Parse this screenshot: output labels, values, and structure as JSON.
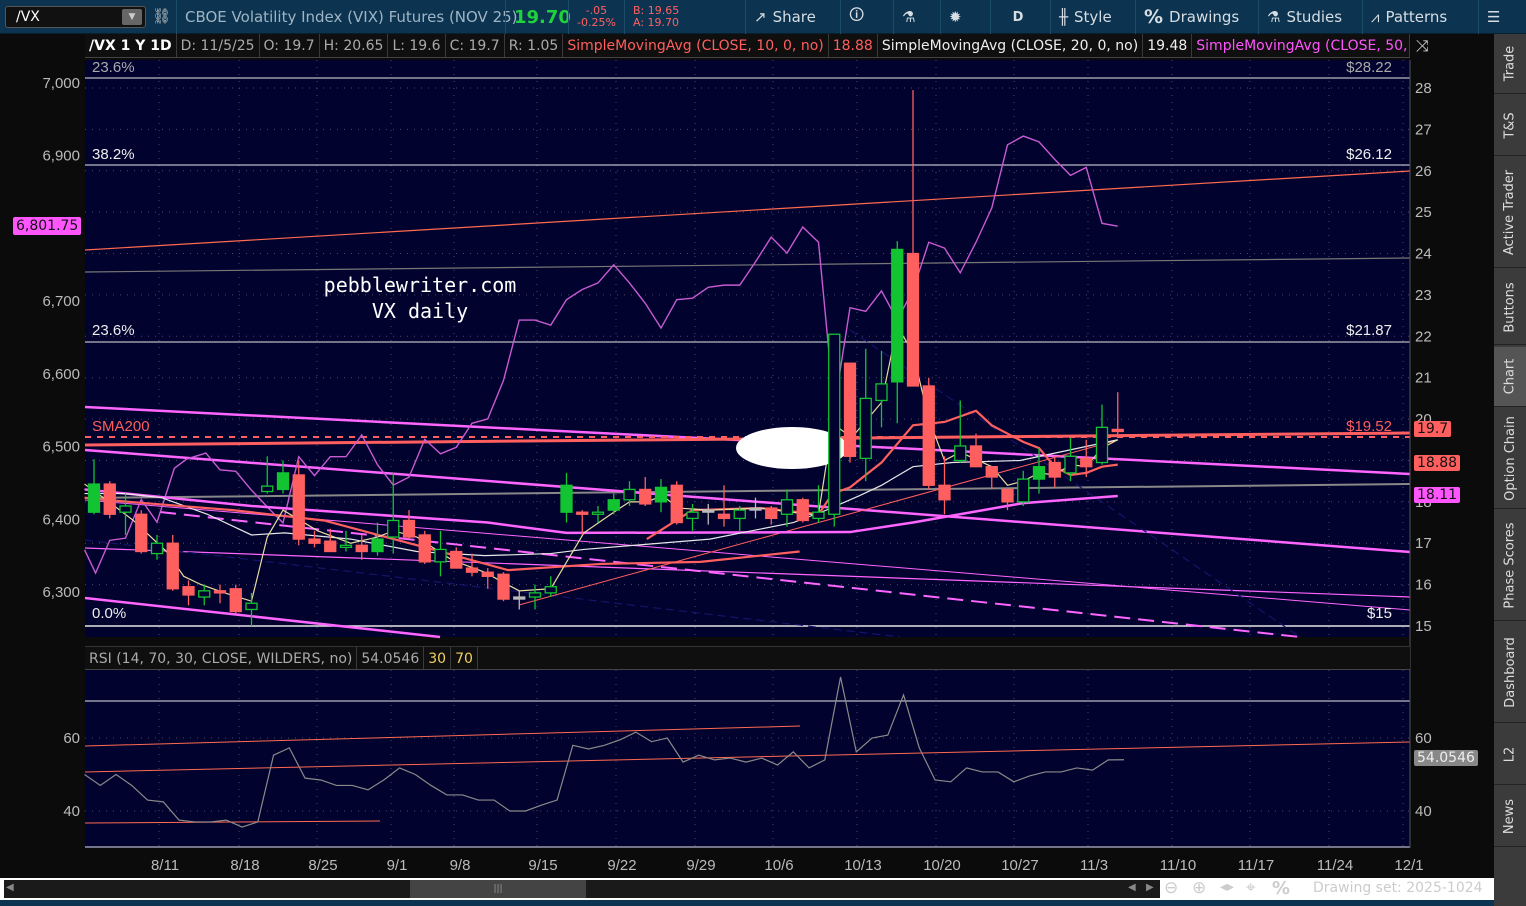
{
  "toolbar": {
    "symbol": "/VX",
    "description": "CBOE Volatility Index (VIX) Futures (NOV 25)",
    "last": "19.70",
    "change": "-.05",
    "change_pct": "-0.25%",
    "bid": "B: 19.65",
    "ask": "A: 19.70",
    "share": "Share",
    "period": "D",
    "style": "Style",
    "drawings": "Drawings",
    "studies": "Studies",
    "patterns": "Patterns"
  },
  "header": {
    "title": "/VX 1 Y 1D",
    "date": "D: 11/5/25",
    "open": "O: 19.7",
    "high": "H: 20.65",
    "low": "L: 19.6",
    "close": "C: 19.7",
    "range": "R: 1.05",
    "sma10_label": "SimpleMovingAvg (CLOSE, 10, 0, no)",
    "sma10_value": "18.88",
    "sma20_label": "SimpleMovingAvg (CLOSE, 20, 0, no)",
    "sma20_value": "19.48",
    "sma50_label": "SimpleMovingAvg (CLOSE, 50,..."
  },
  "colors": {
    "bg": "#02022e",
    "up": "#12c431",
    "down": "#ff5f5f",
    "sma10": "#ff5f5f",
    "sma20": "#e8e8e8",
    "sma50": "#ff66ff",
    "spx": "#c85ad2",
    "fast": "#e8dca0"
  },
  "annotations": {
    "watermark_1": "pebblewriter.com",
    "watermark_2": "VX daily",
    "sma200": "SMA200",
    "fib_top_pct": "23.6%",
    "fib_top_price": "$28.22",
    "fib_382_pct": "38.2%",
    "fib_382_price": "$26.12",
    "fib_236_pct": "23.6%",
    "fib_236_price": "$21.87",
    "fib_0_pct": "0.0%",
    "fib_0_price": "$15",
    "level_1952": "$19.52"
  },
  "left_axis": {
    "ticks": [
      "7,000",
      "6,900",
      "6,700",
      "6,600",
      "6,500",
      "6,400",
      "6,300"
    ],
    "badge": "6,801.75"
  },
  "right_axis": {
    "ticks": [
      "28",
      "27",
      "26",
      "25",
      "24",
      "23",
      "22",
      "21",
      "20",
      "19",
      "18",
      "17",
      "16",
      "15"
    ],
    "badge_last": "19.7",
    "badge_sma10": "18.88",
    "badge_sma50": "18.11"
  },
  "rsi": {
    "label": "RSI (14, 70, 30, CLOSE, WILDERS, no)",
    "value": "54.0546",
    "ob": "30",
    "os": "70",
    "ticks": [
      "60",
      "40"
    ],
    "badge": "54.0546"
  },
  "x_axis": {
    "dates": [
      "8/11",
      "8/18",
      "8/25",
      "9/1",
      "9/8",
      "9/15",
      "9/22",
      "9/29",
      "10/6",
      "10/13",
      "10/20",
      "10/27",
      "11/3",
      "11/10",
      "11/17",
      "11/24",
      "12/1"
    ]
  },
  "footer": {
    "drawing_set": "Drawing set: 2025-1024"
  },
  "sidebar": {
    "tabs": [
      "Trade",
      "T&S",
      "Active Trader",
      "Buttons",
      "Chart",
      "Option Chain",
      "Phase Scores",
      "Dashboard",
      "L2",
      "News"
    ]
  },
  "chart_data": {
    "type": "candlestick",
    "title": "/VX 1 Y 1D",
    "y_range": [
      15,
      28
    ],
    "candles_ohlc": [
      [
        17.75,
        19.03,
        17.7,
        18.43
      ],
      [
        18.43,
        18.5,
        17.6,
        17.7
      ],
      [
        17.75,
        18.2,
        17.2,
        17.9
      ],
      [
        17.7,
        17.8,
        16.75,
        16.8
      ],
      [
        16.75,
        17.2,
        16.6,
        17.0
      ],
      [
        17.0,
        17.2,
        15.85,
        15.9
      ],
      [
        15.95,
        16.1,
        15.5,
        15.75
      ],
      [
        15.7,
        16.0,
        15.5,
        15.85
      ],
      [
        15.85,
        16.0,
        15.55,
        15.8
      ],
      [
        15.9,
        16.0,
        15.3,
        15.35
      ],
      [
        15.4,
        15.8,
        15.0,
        15.55
      ],
      [
        18.25,
        19.1,
        18.2,
        18.38
      ],
      [
        18.3,
        19.0,
        18.2,
        18.7
      ],
      [
        18.65,
        19.0,
        16.95,
        17.1
      ],
      [
        17.1,
        17.3,
        16.9,
        17.0
      ],
      [
        17.05,
        17.35,
        16.8,
        16.8
      ],
      [
        16.9,
        17.3,
        16.8,
        16.95
      ],
      [
        16.95,
        17.2,
        16.6,
        16.8
      ],
      [
        16.8,
        17.5,
        16.7,
        17.1
      ],
      [
        17.15,
        18.7,
        16.75,
        17.55
      ],
      [
        17.55,
        17.8,
        17.1,
        17.15
      ],
      [
        17.2,
        17.3,
        16.5,
        16.55
      ],
      [
        16.55,
        17.3,
        16.2,
        16.85
      ],
      [
        16.8,
        16.9,
        16.4,
        16.4
      ],
      [
        16.4,
        16.75,
        16.2,
        16.3
      ],
      [
        16.3,
        16.4,
        15.9,
        16.2
      ],
      [
        16.25,
        16.3,
        15.6,
        15.65
      ],
      [
        15.7,
        15.85,
        15.4,
        15.7
      ],
      [
        15.7,
        16.0,
        15.4,
        15.8
      ],
      [
        15.8,
        16.2,
        15.7,
        15.95
      ],
      [
        17.75,
        18.7,
        17.5,
        18.4
      ],
      [
        17.75,
        17.8,
        17.2,
        17.7
      ],
      [
        17.7,
        17.9,
        17.5,
        17.75
      ],
      [
        17.8,
        18.2,
        17.7,
        18.05
      ],
      [
        18.05,
        18.5,
        17.9,
        18.3
      ],
      [
        18.3,
        18.6,
        17.9,
        17.95
      ],
      [
        18.0,
        18.55,
        17.75,
        18.35
      ],
      [
        18.4,
        18.5,
        17.45,
        17.5
      ],
      [
        17.6,
        17.95,
        17.3,
        17.75
      ],
      [
        17.8,
        17.95,
        17.45,
        17.8
      ],
      [
        17.7,
        18.4,
        17.4,
        17.6
      ],
      [
        17.6,
        17.9,
        17.3,
        17.8
      ],
      [
        17.85,
        18.1,
        17.6,
        17.85
      ],
      [
        17.85,
        17.9,
        17.45,
        17.6
      ],
      [
        17.7,
        18.3,
        17.4,
        18.05
      ],
      [
        18.05,
        18.1,
        17.5,
        17.55
      ],
      [
        17.6,
        18.4,
        17.5,
        17.75
      ],
      [
        17.7,
        22.05,
        17.4,
        22.05
      ],
      [
        21.35,
        21.35,
        18.95,
        19.1
      ],
      [
        19.05,
        21.7,
        18.5,
        20.5
      ],
      [
        20.45,
        21.65,
        19.8,
        20.85
      ],
      [
        20.9,
        24.3,
        19.9,
        24.1
      ],
      [
        24.0,
        27.95,
        20.8,
        20.8
      ],
      [
        20.8,
        21.0,
        18.3,
        18.4
      ],
      [
        18.4,
        19.1,
        17.7,
        18.05
      ],
      [
        19.0,
        20.45,
        18.95,
        19.35
      ],
      [
        19.35,
        19.65,
        18.85,
        18.85
      ],
      [
        18.85,
        18.85,
        18.3,
        18.6
      ],
      [
        18.3,
        18.3,
        17.8,
        18.0
      ],
      [
        18.0,
        18.75,
        17.9,
        18.55
      ],
      [
        18.55,
        19.3,
        18.2,
        18.85
      ],
      [
        18.95,
        19.1,
        18.35,
        18.6
      ],
      [
        18.7,
        19.55,
        18.5,
        19.1
      ],
      [
        19.05,
        19.5,
        18.6,
        18.85
      ],
      [
        18.95,
        20.35,
        18.9,
        19.8
      ],
      [
        19.75,
        20.65,
        19.6,
        19.7
      ]
    ],
    "sma10": [
      [
        -0.6,
        18.1
      ],
      [
        0.6,
        18.05
      ],
      [
        8.8,
        17.8
      ],
      [
        14.6,
        17.55
      ],
      [
        21,
        16.9
      ],
      [
        26.3,
        16.35
      ],
      [
        32.2,
        16.5
      ],
      [
        38.5,
        16.55
      ],
      [
        44.8,
        16.8
      ],
      [
        35.1,
        17.1
      ]
    ],
    "sma10_b": [
      [
        35.1,
        17.1
      ],
      [
        38,
        17.8
      ],
      [
        42.3,
        17.85
      ],
      [
        46,
        17.7
      ],
      [
        46.9,
        18.2
      ],
      [
        48,
        18.35
      ],
      [
        50,
        18.95
      ],
      [
        52,
        19.85
      ],
      [
        54,
        19.93
      ],
      [
        56,
        20.2
      ],
      [
        57,
        19.85
      ],
      [
        59,
        19.45
      ],
      [
        60,
        19.3
      ],
      [
        61,
        18.85
      ],
      [
        62,
        18.65
      ],
      [
        63,
        18.7
      ],
      [
        64,
        18.85
      ],
      [
        65,
        18.9
      ]
    ],
    "sma20": [
      [
        -0.6,
        18.2
      ],
      [
        1.9,
        18.2
      ],
      [
        4.3,
        18.1
      ],
      [
        7.2,
        17.7
      ],
      [
        10,
        17.2
      ],
      [
        12.1,
        17.25
      ],
      [
        16.3,
        17.1
      ],
      [
        20.5,
        16.8
      ],
      [
        24.8,
        16.7
      ],
      [
        29,
        16.75
      ],
      [
        31.1,
        16.85
      ],
      [
        39.1,
        17.1
      ],
      [
        44.4,
        17.5
      ],
      [
        46.5,
        17.8
      ],
      [
        48.6,
        18.15
      ],
      [
        50,
        18.4
      ],
      [
        52,
        18.85
      ],
      [
        54.5,
        18.95
      ],
      [
        58.8,
        19.0
      ],
      [
        65,
        19.5
      ]
    ],
    "sma50": [
      [
        -0.6,
        18.3
      ],
      [
        10,
        17.9
      ],
      [
        25,
        17.5
      ],
      [
        30,
        17.25
      ],
      [
        48,
        17.27
      ],
      [
        52,
        17.5
      ],
      [
        59,
        17.97
      ],
      [
        65,
        18.14
      ]
    ],
    "fast_ma": [
      [
        -0.6,
        18.43
      ],
      [
        0.6,
        18.1
      ],
      [
        2.5,
        17.55
      ],
      [
        4.6,
        16.8
      ],
      [
        5.7,
        16.2
      ],
      [
        6.8,
        16.0
      ],
      [
        8.3,
        15.8
      ],
      [
        10,
        15.6
      ],
      [
        11,
        17.15
      ],
      [
        12,
        17.8
      ],
      [
        14.2,
        17.3
      ],
      [
        16.3,
        17.0
      ],
      [
        18,
        17.15
      ],
      [
        19,
        17.3
      ],
      [
        20.5,
        17.15
      ],
      [
        22.7,
        16.6
      ],
      [
        24.8,
        16.3
      ],
      [
        26,
        16.05
      ],
      [
        27,
        15.85
      ],
      [
        29,
        15.9
      ],
      [
        31.1,
        17.25
      ],
      [
        33,
        17.75
      ],
      [
        34,
        18.0
      ],
      [
        35.1,
        18.0
      ],
      [
        36.1,
        18.15
      ],
      [
        37.1,
        17.85
      ],
      [
        39.1,
        17.8
      ],
      [
        42.3,
        17.85
      ],
      [
        45.3,
        17.7
      ],
      [
        46,
        17.7
      ],
      [
        46.9,
        19.9
      ],
      [
        48.1,
        19.55
      ],
      [
        50,
        20.4
      ],
      [
        51,
        22.25
      ],
      [
        52,
        21.6
      ],
      [
        53,
        20.0
      ],
      [
        54,
        19.0
      ],
      [
        55,
        19.2
      ],
      [
        57,
        18.85
      ],
      [
        58,
        18.4
      ],
      [
        59,
        18.5
      ],
      [
        60,
        18.7
      ],
      [
        61,
        18.65
      ],
      [
        62,
        18.9
      ],
      [
        63,
        18.85
      ],
      [
        64,
        19.3
      ],
      [
        65,
        19.5
      ]
    ],
    "spx_overlay": [
      [
        -0.6,
        6358
      ],
      [
        0.1,
        6326
      ],
      [
        1,
        6371
      ],
      [
        2,
        6374
      ],
      [
        3,
        6427
      ],
      [
        4,
        6396
      ],
      [
        5.1,
        6470
      ],
      [
        5.9,
        6483
      ],
      [
        7.1,
        6491
      ],
      [
        8,
        6468
      ],
      [
        9,
        6466
      ],
      [
        10,
        6440
      ],
      [
        11,
        6417
      ],
      [
        12,
        6395
      ],
      [
        13,
        6486
      ],
      [
        14,
        6460
      ],
      [
        15,
        6486
      ],
      [
        16,
        6486
      ],
      [
        17,
        6516
      ],
      [
        18,
        6475
      ],
      [
        19,
        6447
      ],
      [
        20,
        6458
      ],
      [
        21,
        6510
      ],
      [
        22,
        6490
      ],
      [
        23,
        6499
      ],
      [
        24,
        6532
      ],
      [
        25,
        6538
      ],
      [
        26,
        6591
      ],
      [
        27,
        6674
      ],
      [
        28,
        6674
      ],
      [
        29,
        6667
      ],
      [
        30,
        6702
      ],
      [
        31,
        6716
      ],
      [
        32,
        6725
      ],
      [
        33,
        6750
      ],
      [
        34,
        6725
      ],
      [
        35,
        6697
      ],
      [
        36,
        6663
      ],
      [
        37,
        6702
      ],
      [
        38,
        6704
      ],
      [
        39,
        6719
      ],
      [
        40,
        6722
      ],
      [
        41,
        6722
      ],
      [
        42,
        6754
      ],
      [
        43,
        6788
      ],
      [
        44,
        6766
      ],
      [
        45,
        6802
      ],
      [
        46,
        6781
      ],
      [
        47,
        6553
      ],
      [
        48,
        6691
      ],
      [
        49,
        6686
      ],
      [
        50,
        6714
      ],
      [
        51,
        6674
      ],
      [
        52,
        6715
      ],
      [
        53,
        6781
      ],
      [
        54,
        6773
      ],
      [
        55,
        6739
      ],
      [
        56,
        6781
      ],
      [
        57,
        6828
      ],
      [
        58,
        6915
      ],
      [
        59,
        6927
      ],
      [
        60,
        6919
      ],
      [
        61,
        6895
      ],
      [
        62,
        6873
      ],
      [
        63,
        6884
      ],
      [
        64,
        6807
      ],
      [
        65,
        6803
      ]
    ],
    "rsi_series": [
      50,
      47,
      50,
      47,
      43,
      42.5,
      37.5,
      37,
      37,
      37.5,
      35.6,
      37,
      55.3,
      57.3,
      49,
      48.5,
      47,
      47,
      45.8,
      48.5,
      51.8,
      50,
      47,
      44.4,
      44.4,
      43,
      43,
      40,
      40,
      41.6,
      43,
      58,
      57,
      58,
      59.5,
      61.6,
      59,
      60,
      53.4,
      55.3,
      54,
      54.5,
      53.4,
      54.5,
      52.6,
      56.2,
      51.8,
      54,
      76.7,
      56.2,
      60,
      60.8,
      71.8,
      57.3,
      48.5,
      48,
      51.8,
      50.7,
      50.7,
      48,
      49.6,
      50.7,
      50.7,
      51.8,
      51.2,
      54,
      54.05
    ]
  }
}
